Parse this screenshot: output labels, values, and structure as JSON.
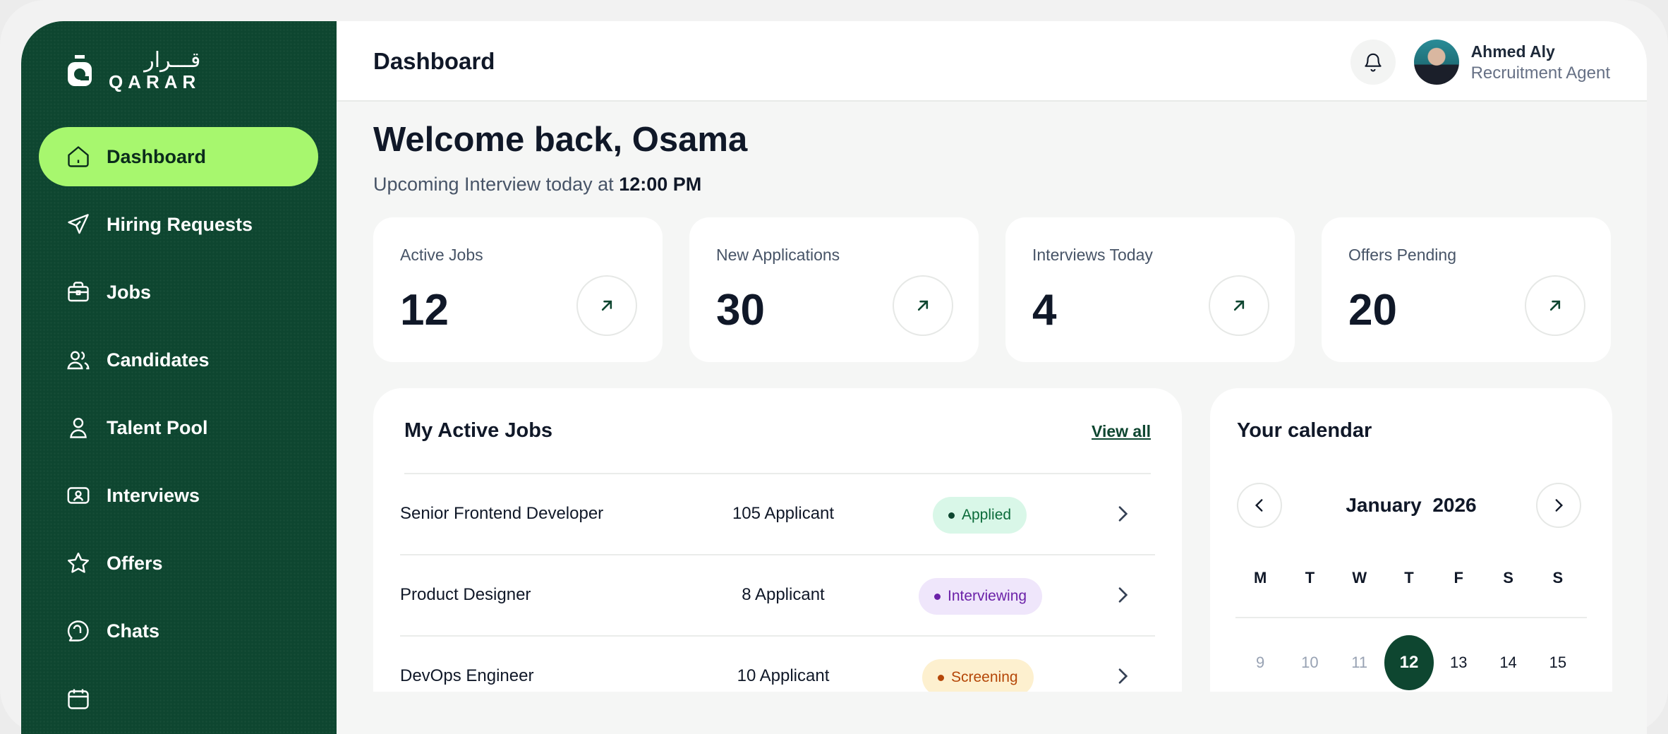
{
  "brand": {
    "arabic": "قـــرار",
    "latin": "QARAR",
    "accent": "#a7f76e",
    "primary": "#0e4630"
  },
  "sidebar": {
    "items": [
      {
        "label": "Dashboard",
        "icon": "home-icon",
        "active": true
      },
      {
        "label": "Hiring Requests",
        "icon": "send-icon"
      },
      {
        "label": "Jobs",
        "icon": "briefcase-icon"
      },
      {
        "label": "Candidates",
        "icon": "users-icon"
      },
      {
        "label": "Talent Pool",
        "icon": "user-icon"
      },
      {
        "label": "Interviews",
        "icon": "video-icon"
      },
      {
        "label": "Offers",
        "icon": "star-icon"
      },
      {
        "label": "Chats",
        "icon": "chat-icon"
      }
    ]
  },
  "header": {
    "title": "Dashboard",
    "user": {
      "name": "Ahmed Aly",
      "role": "Recruitment Agent"
    }
  },
  "main": {
    "welcome": "Welcome back, Osama",
    "upcoming_prefix": "Upcoming Interview today at",
    "upcoming_time": "12:00 PM",
    "stats": [
      {
        "label": "Active Jobs",
        "value": "12"
      },
      {
        "label": "New Applications",
        "value": "30"
      },
      {
        "label": "Interviews Today",
        "value": "4"
      },
      {
        "label": "Offers Pending",
        "value": "20"
      }
    ],
    "jobs": {
      "title": "My Active Jobs",
      "view_all": "View all",
      "rows": [
        {
          "name": "Senior Frontend Developer",
          "applicants": "105 Applicant",
          "status": "Applied",
          "status_bg": "#d9f7e8",
          "status_fg": "#0b6b3a",
          "status_dot": "#0e4630"
        },
        {
          "name": "Product Designer",
          "applicants": "8 Applicant",
          "status": "Interviewing",
          "status_bg": "#efe6fb",
          "status_fg": "#6b21a8",
          "status_dot": "#6b21a8"
        },
        {
          "name": "DevOps Engineer",
          "applicants": "10 Applicant",
          "status": "Screening",
          "status_bg": "#fdf0cf",
          "status_fg": "#b54708",
          "status_dot": "#b54708"
        }
      ]
    },
    "calendar": {
      "title": "Your calendar",
      "month": "January",
      "year": "2026",
      "weekdays": [
        "M",
        "T",
        "W",
        "T",
        "F",
        "S",
        "S"
      ],
      "days": [
        {
          "d": "9",
          "kind": "muted"
        },
        {
          "d": "10",
          "kind": "muted"
        },
        {
          "d": "11",
          "kind": "muted"
        },
        {
          "d": "12",
          "kind": "sel"
        },
        {
          "d": "13",
          "kind": "norm"
        },
        {
          "d": "14",
          "kind": "norm"
        },
        {
          "d": "15",
          "kind": "norm"
        }
      ]
    }
  }
}
